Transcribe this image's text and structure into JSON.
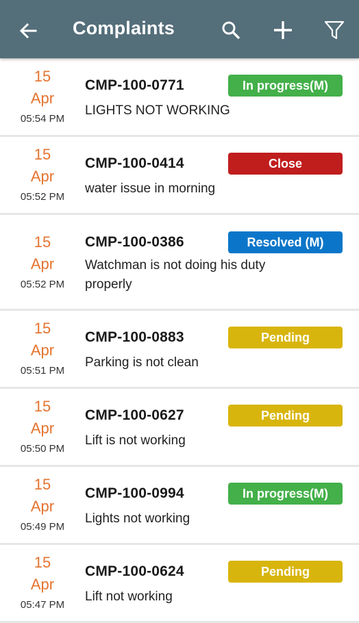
{
  "appbar": {
    "title": "Complaints",
    "icons": [
      "back-arrow-icon",
      "search-icon",
      "add-icon",
      "filter-icon"
    ]
  },
  "status_colors": {
    "In progress(M)": "#43b049",
    "Close": "#c01d1d",
    "Resolved (M)": "#0b76c9",
    "Pending": "#d8b50d"
  },
  "complaints": [
    {
      "day": "15",
      "month": "Apr",
      "time": "05:54 PM",
      "id": "CMP-100-0771",
      "status": "In progress(M)",
      "description": "LIGHTS NOT WORKING"
    },
    {
      "day": "15",
      "month": "Apr",
      "time": "05:52 PM",
      "id": "CMP-100-0414",
      "status": "Close",
      "description": "water issue in morning"
    },
    {
      "day": "15",
      "month": "Apr",
      "time": "05:52 PM",
      "id": "CMP-100-0386",
      "status": "Resolved (M)",
      "description": "Watchman is not doing his duty properly"
    },
    {
      "day": "15",
      "month": "Apr",
      "time": "05:51 PM",
      "id": "CMP-100-0883",
      "status": "Pending",
      "description": "Parking is not clean"
    },
    {
      "day": "15",
      "month": "Apr",
      "time": "05:50 PM",
      "id": "CMP-100-0627",
      "status": "Pending",
      "description": "Lift is not working"
    },
    {
      "day": "15",
      "month": "Apr",
      "time": "05:49 PM",
      "id": "CMP-100-0994",
      "status": "In progress(M)",
      "description": "Lights not working"
    },
    {
      "day": "15",
      "month": "Apr",
      "time": "05:47 PM",
      "id": "CMP-100-0624",
      "status": "Pending",
      "description": "Lift not working"
    }
  ]
}
